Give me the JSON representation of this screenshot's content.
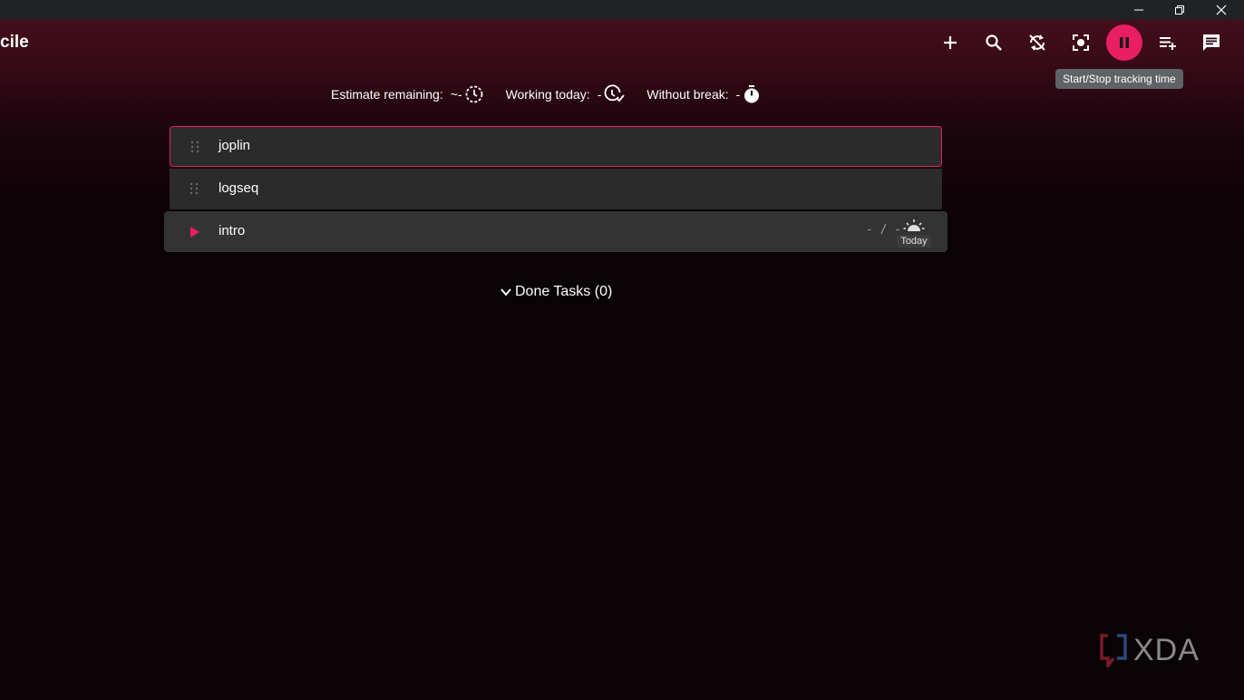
{
  "app": {
    "title": "cile"
  },
  "window_controls": {
    "minimize_icon": "minimize-icon",
    "restore_icon": "restore-icon",
    "close_icon": "close-icon"
  },
  "toolbar": {
    "buttons": [
      {
        "icon": "plus-icon"
      },
      {
        "icon": "search-icon"
      },
      {
        "icon": "sync-disabled-icon"
      },
      {
        "icon": "focus-icon"
      },
      {
        "icon": "pause-icon"
      },
      {
        "icon": "playlist-add-icon"
      },
      {
        "icon": "chat-icon"
      }
    ],
    "tooltip": "Start/Stop tracking time",
    "accent_color": "#e91e63"
  },
  "metrics": {
    "estimate_label": "Estimate remaining:",
    "estimate_value": "~-",
    "working_label": "Working today:",
    "working_value": "-",
    "break_label": "Without break:",
    "break_value": "-"
  },
  "tasks": [
    {
      "title": "joplin"
    },
    {
      "title": "logseq"
    },
    {
      "title": "intro",
      "time": "- / -",
      "badge": "Today"
    }
  ],
  "done": {
    "label": "Done Tasks (0)"
  },
  "watermark": {
    "text": "XDA"
  }
}
